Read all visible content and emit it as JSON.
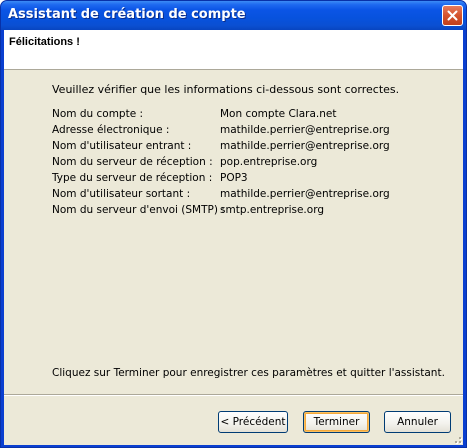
{
  "window": {
    "title": "Assistant de création de compte"
  },
  "header": {
    "title": "Félicitations !"
  },
  "content": {
    "intro": "Veuillez vérifier que les informations ci-dessous sont correctes.",
    "fields": [
      {
        "label": "Nom du compte :",
        "value": "Mon compte Clara.net"
      },
      {
        "label": "Adresse électronique :",
        "value": "mathilde.perrier@entreprise.org"
      },
      {
        "label": "Nom d'utilisateur entrant :",
        "value": "mathilde.perrier@entreprise.org"
      },
      {
        "label": "Nom du serveur de réception :",
        "value": "pop.entreprise.org"
      },
      {
        "label": "Type du serveur de réception :",
        "value": "POP3"
      },
      {
        "label": "Nom d'utilisateur sortant :",
        "value": "mathilde.perrier@entreprise.org"
      },
      {
        "label": "Nom du serveur d'envoi (SMTP) :",
        "value": "smtp.entreprise.org"
      }
    ],
    "finish_note": "Cliquez sur Terminer pour enregistrer ces paramètres et quitter l'assistant."
  },
  "buttons": {
    "previous": "< Précédent",
    "finish": "Terminer",
    "cancel": "Annuler"
  },
  "icons": {
    "close": "close-icon",
    "resize": "resize-grip-icon"
  },
  "colors": {
    "titlebar": "#0752dd",
    "dialog_bg": "#ece9d8",
    "close_button": "#d4532e",
    "button_border": "#003c74",
    "default_button_focus": "#f3a93b"
  }
}
